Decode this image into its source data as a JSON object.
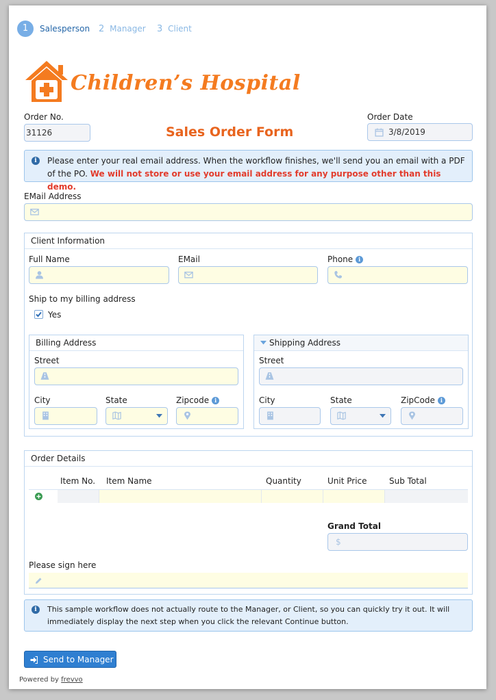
{
  "steps": [
    {
      "num": "1",
      "label": "Salesperson"
    },
    {
      "num": "2",
      "label": "Manager"
    },
    {
      "num": "3",
      "label": "Client"
    }
  ],
  "logo": {
    "text": "Children’s Hospital"
  },
  "order": {
    "order_no_label": "Order No.",
    "order_no_value": "31126",
    "form_title": "Sales Order Form",
    "order_date_label": "Order Date",
    "order_date_value": "3/8/2019"
  },
  "notice1": {
    "text": "Please enter your real email address. When the workflow finishes, we'll send you an email with a PDF of the PO.",
    "emphasis": "We will not store or use your email address for any purpose other than this demo."
  },
  "email_label": "EMail Address",
  "client": {
    "title": "Client Information",
    "full_name_label": "Full Name",
    "email_label": "EMail",
    "phone_label": "Phone",
    "ship_label": "Ship to my billing address",
    "ship_yes": "Yes"
  },
  "billing": {
    "title": "Billing Address",
    "street_label": "Street",
    "city_label": "City",
    "state_label": "State",
    "zip_label": "Zipcode"
  },
  "shipping": {
    "title": "Shipping Address",
    "street_label": "Street",
    "city_label": "City",
    "state_label": "State",
    "zip_label": "ZipCode"
  },
  "order_details": {
    "title": "Order Details",
    "columns": [
      "Item No.",
      "Item Name",
      "Quantity",
      "Unit Price",
      "Sub Total"
    ],
    "grand_total_label": "Grand Total",
    "currency": "$",
    "sign_label": "Please sign here"
  },
  "notice2": {
    "text": "This sample workflow does not actually route to the Manager, or Client, so you can quickly try it out. It will immediately display the next step when you click the relevant Continue button."
  },
  "send_button": "Send to Manager",
  "footer": {
    "powered": "Powered by",
    "brand": "frevvo"
  },
  "colors": {
    "accent": "#2f7fd1",
    "logo_orange": "#f47b20",
    "title_orange": "#e8641e",
    "warning_red": "#e23c2c"
  }
}
